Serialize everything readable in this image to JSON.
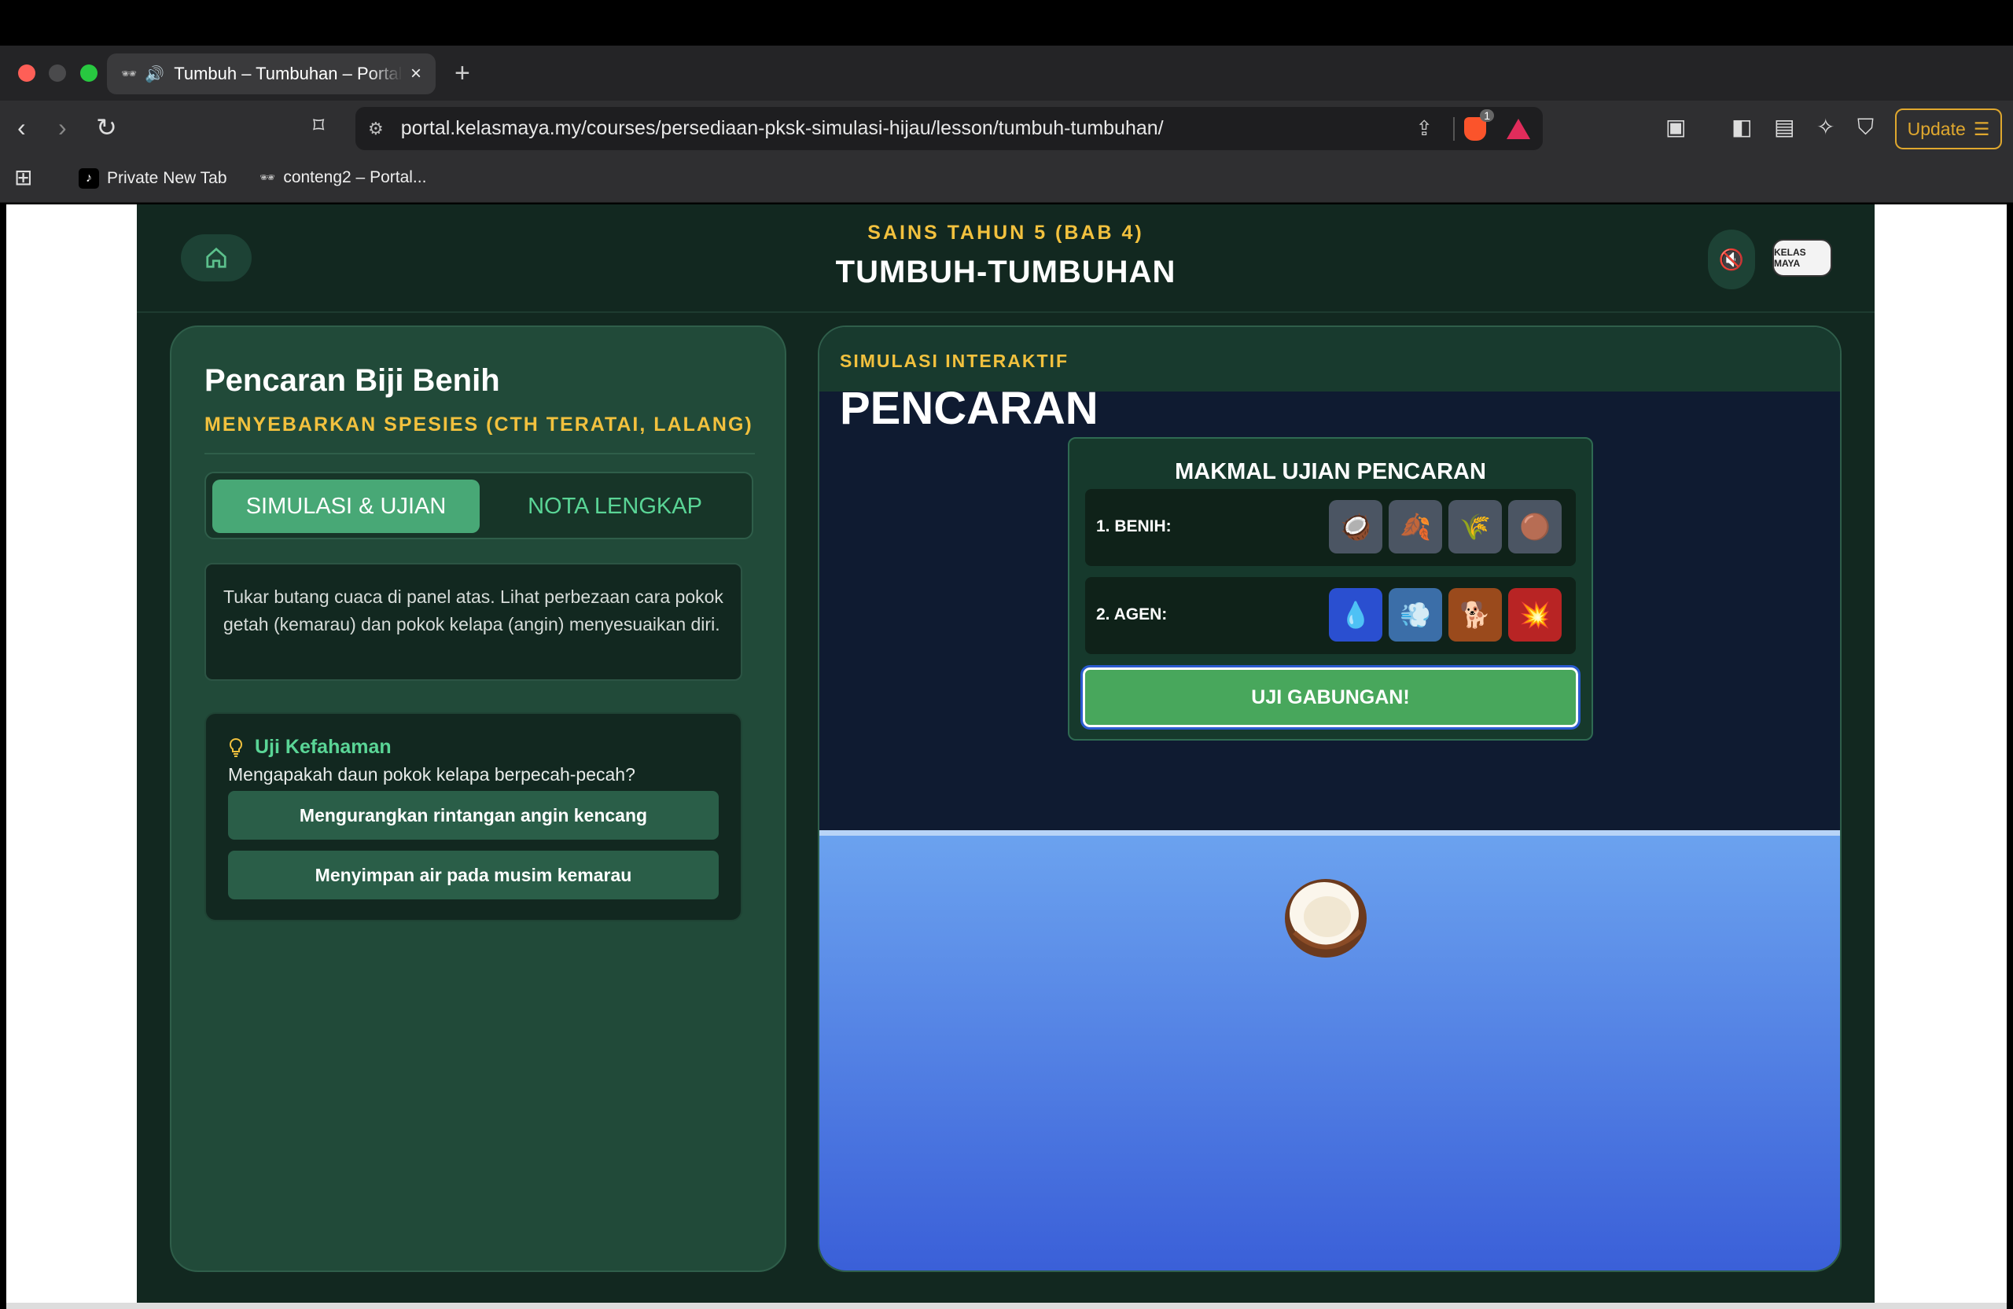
{
  "browser": {
    "tab_title": "Tumbuh – Tumbuhan – Portal",
    "tab_icon": "incognito-icon",
    "url": "portal.kelasmaya.my/courses/persediaan-pksk-simulasi-hijau/lesson/tumbuh-tumbuhan/",
    "brave_badge": "1",
    "update_label": "Update",
    "bookmarks": [
      {
        "label": "Private New Tab",
        "icon": "tiktok-icon"
      },
      {
        "label": "conteng2 – Portal...",
        "icon": "incognito-icon"
      }
    ]
  },
  "header": {
    "subtitle": "SAINS TAHUN 5 (BAB 4)",
    "title": "TUMBUH-TUMBUHAN",
    "logo_text": "KELAS MAYA"
  },
  "left_panel": {
    "title": "Pencaran Biji Benih",
    "subtitle": "MENYEBARKAN SPESIES (CTH TERATAI, LALANG)",
    "tabs": [
      {
        "label": "SIMULASI & UJIAN",
        "active": true
      },
      {
        "label": "NOTA LENGKAP",
        "active": false
      }
    ],
    "instructions": "Tukar butang cuaca di panel atas. Lihat perbezaan cara pokok getah (kemarau) dan pokok kelapa (angin) menyesuaikan diri.",
    "quiz": {
      "heading": "Uji Kefahaman",
      "question": "Mengapakah daun pokok kelapa berpecah-pecah?",
      "options": [
        "Mengurangkan rintangan angin kencang",
        "Menyimpan air pada musim kemarau"
      ]
    }
  },
  "right_panel": {
    "tag": "SIMULASI INTERAKTIF",
    "title": "PENCARAN",
    "lab": {
      "title": "MAKMAL UJIAN PENCARAN",
      "seed_label": "1. BENIH:",
      "seeds": [
        "🥥",
        "🍂",
        "🌾",
        "🟤"
      ],
      "agent_label": "2. AGEN:",
      "agents": [
        "💧",
        "💨",
        "🐕",
        "💥"
      ],
      "test_button": "UJI GABUNGAN!"
    }
  },
  "colors": {
    "accent_yellow": "#f2c13e",
    "accent_green": "#48a876",
    "app_bg": "#122820"
  }
}
